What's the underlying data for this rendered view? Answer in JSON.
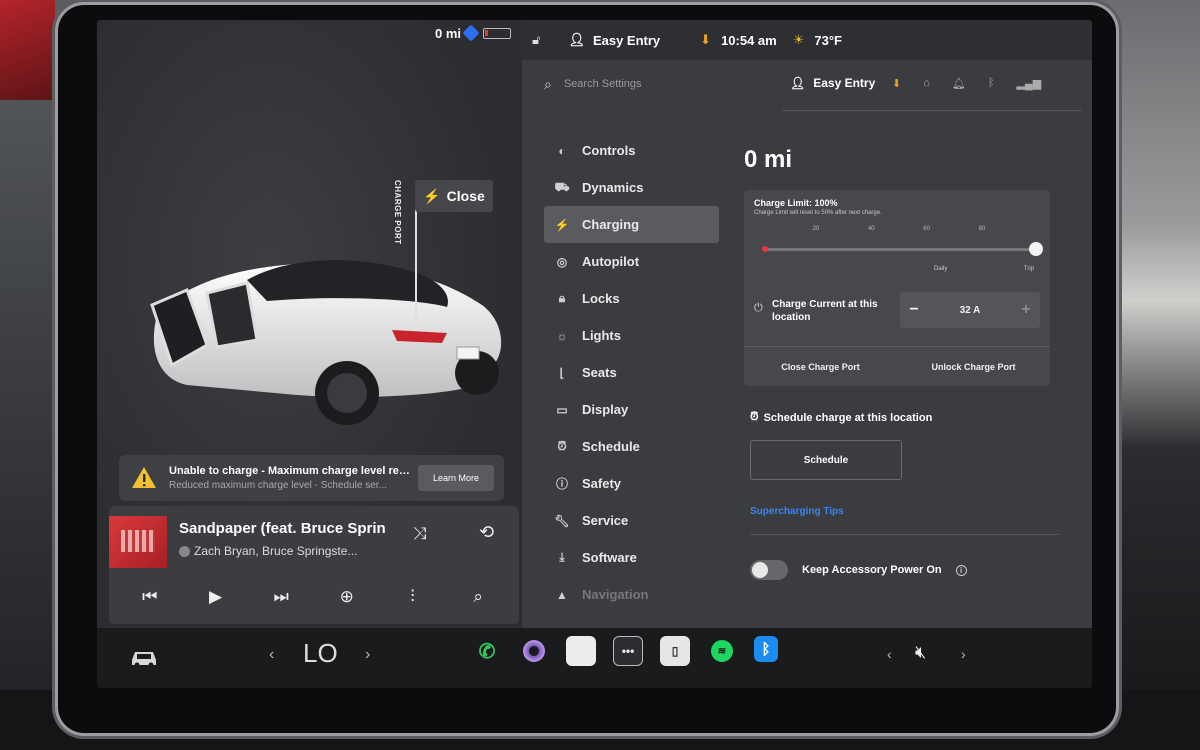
{
  "status_bar_left": {
    "range": "0 mi"
  },
  "status_bar_right": {
    "profile": "Easy Entry",
    "time": "10:54 am",
    "temperature": "73°F"
  },
  "car_view": {
    "charge_port_label": "CHARGE PORT",
    "close_button": "Close"
  },
  "alert": {
    "title": "Unable to charge - Maximum charge level reach...",
    "subtitle": "Reduced maximum charge level - Schedule ser...",
    "button": "Learn More"
  },
  "media": {
    "song_title": "Sandpaper (feat. Bruce Sprin",
    "artist": "Zach Bryan, Bruce Springste...",
    "controls": [
      "previous",
      "play",
      "next",
      "add",
      "equalizer",
      "search"
    ]
  },
  "settings": {
    "search_placeholder": "Search Settings",
    "profile": "Easy Entry",
    "nav": [
      {
        "label": "Controls",
        "icon": "toggle-icon"
      },
      {
        "label": "Dynamics",
        "icon": "car-icon"
      },
      {
        "label": "Charging",
        "icon": "bolt-icon",
        "active": true
      },
      {
        "label": "Autopilot",
        "icon": "steering-wheel-icon"
      },
      {
        "label": "Locks",
        "icon": "lock-icon"
      },
      {
        "label": "Lights",
        "icon": "light-icon"
      },
      {
        "label": "Seats",
        "icon": "seat-icon"
      },
      {
        "label": "Display",
        "icon": "display-icon"
      },
      {
        "label": "Schedule",
        "icon": "alarm-icon"
      },
      {
        "label": "Safety",
        "icon": "info-icon"
      },
      {
        "label": "Service",
        "icon": "wrench-icon"
      },
      {
        "label": "Software",
        "icon": "download-icon"
      },
      {
        "label": "Navigation",
        "icon": "navigation-icon"
      }
    ]
  },
  "charging": {
    "range": "0 mi",
    "charge_limit_title": "Charge Limit: 100%",
    "charge_limit_sub": "Charge Limit will reset to 50% after next charge.",
    "charge_limit_percent": 100,
    "ticks": [
      "20",
      "40",
      "60",
      "80"
    ],
    "daily_label": "Daily",
    "trip_label": "Trip",
    "charge_current_label": "Charge Current at this location",
    "charge_current_value": "32 A",
    "close_charge_port": "Close Charge Port",
    "unlock_charge_port": "Unlock Charge Port",
    "schedule_label": "Schedule charge at this location",
    "schedule_button": "Schedule",
    "supercharger_tips": "Supercharging Tips",
    "accessory_power_label": "Keep Accessory Power On",
    "accessory_power_on": false
  },
  "dock": {
    "climate_temp": "LO",
    "apps": [
      "phone-icon",
      "camera-icon",
      "notes-icon",
      "more-apps-icon",
      "manual-icon",
      "spotify-icon",
      "bluetooth-icon"
    ],
    "volume": "muted"
  },
  "colors": {
    "accent_blue": "#3a84f0",
    "alert_yellow": "#f2c230",
    "charge_red": "#e53935",
    "download_orange": "#f0a020"
  }
}
